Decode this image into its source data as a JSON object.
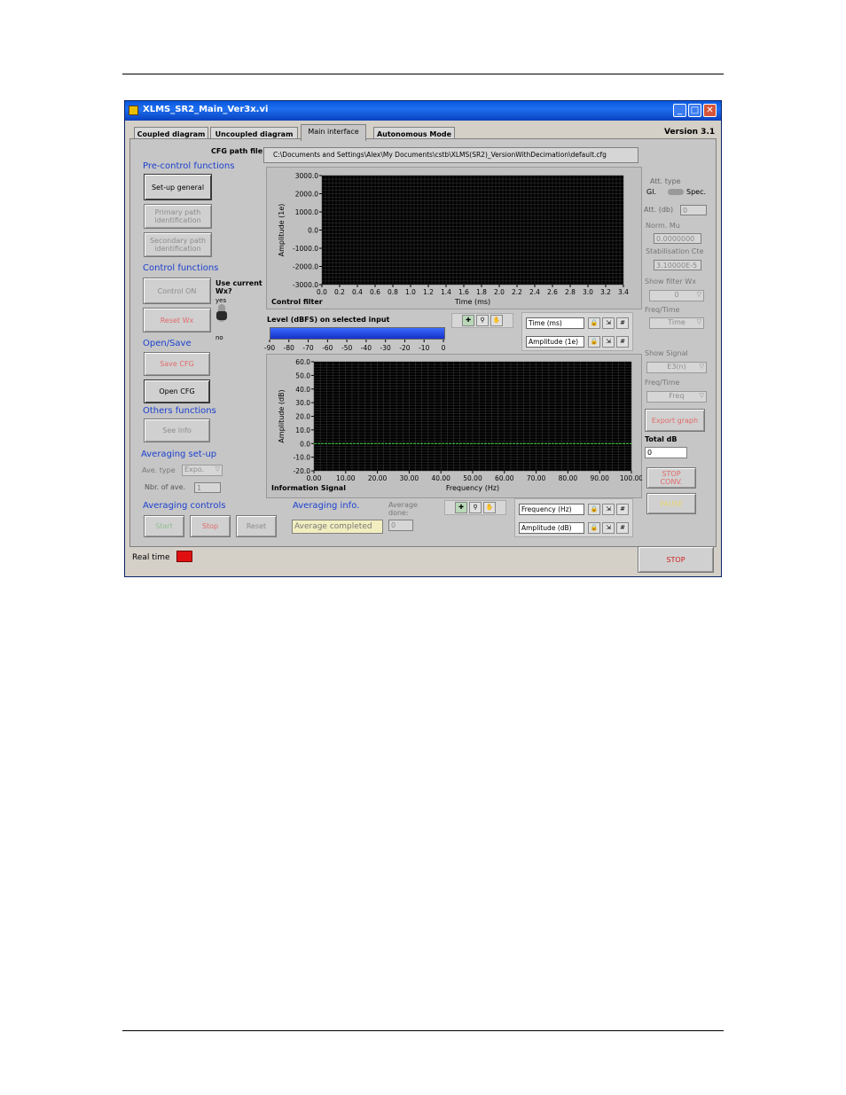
{
  "window": {
    "title": "XLMS_SR2_Main_Ver3x.vi",
    "controls": [
      "_",
      "□",
      "✕"
    ]
  },
  "tabs": [
    "Coupled diagram",
    "Uncoupled diagram",
    "Main interface",
    "Autonomous Mode"
  ],
  "version": "Version 3.1",
  "cfg": {
    "label": "CFG path file",
    "path": "C:\\Documents and Settings\\Alex\\My Documents\\cstb\\XLMS(SR2)_VersionWithDecimation\\default.cfg"
  },
  "sections": {
    "precontrol": "Pre-control functions",
    "control": "Control functions",
    "opensave": "Open/Save",
    "others": "Others functions",
    "averaging_setup": "Averaging set-up",
    "averaging_controls": "Averaging controls",
    "averaging_info": "Averaging info."
  },
  "buttons": {
    "setup_general": "Set-up general",
    "primary_path": [
      "Primary path",
      "identification"
    ],
    "secondary_path": [
      "Secondary path",
      "identification"
    ],
    "control_on": "Control ON",
    "reset_wx": "Reset Wx",
    "save_cfg": "Save CFG",
    "open_cfg": "Open CFG",
    "see_info": "See info",
    "start": "Start",
    "stop_avg": "Stop",
    "reset": "Reset",
    "export_graph": "Export graph",
    "stop_conv": [
      "STOP",
      "CONV."
    ],
    "pause": [
      "PAUSE"
    ],
    "stop": "STOP"
  },
  "use_wx": {
    "label": [
      "Use current",
      "Wx?"
    ],
    "yes": "yes",
    "no": "no"
  },
  "ave": {
    "type_label": "Ave. type",
    "type_value": "Expo.",
    "nbr_label": "Nbr. of ave.",
    "nbr_value": "1",
    "done_label": [
      "Average",
      "done:"
    ],
    "done_value": "0",
    "status": "Average completed"
  },
  "right": {
    "att_type": "Att. type",
    "gl": "Gl.",
    "spec": "Spec.",
    "att_db_label": "Att. (db)",
    "att_db_value": "0",
    "norm_mu_label": "Norm. Mu",
    "norm_mu_value": "0.0000000",
    "stab_label": "Stabilisation Cte",
    "stab_value": "3.10000E-5",
    "show_filter_label": "Show filter Wx",
    "show_filter_value": "0",
    "freqtime1_label": "Freq/Time",
    "freqtime1_value": "Time",
    "show_signal_label": "Show Signal",
    "show_signal_value": "E3(n)",
    "freqtime2_label": "Freq/Time",
    "freqtime2_value": "Freq",
    "total_db_label": "Total dB",
    "total_db_value": "0"
  },
  "level": {
    "label": "Level (dBFS) on selected input",
    "ticks": [
      "-90",
      "-80",
      "-70",
      "-60",
      "-50",
      "-40",
      "-30",
      "-20",
      "-10",
      "0"
    ],
    "fill": 1.0
  },
  "legend1": {
    "x": "Time (ms)",
    "y": "Amplitude (1e)"
  },
  "legend2": {
    "x": "Frequency (Hz)",
    "y": "Amplitude (dB)"
  },
  "realtime": "Real time",
  "chart_data": [
    {
      "type": "line",
      "title": "Control filter",
      "xlabel": "Time (ms)",
      "ylabel": "Amplitude (1e)",
      "xlim": [
        0,
        3.4
      ],
      "ylim": [
        -3000,
        3000
      ],
      "x_ticks": [
        "0.0",
        "0.2",
        "0.4",
        "0.6",
        "0.8",
        "1.0",
        "1.2",
        "1.4",
        "1.6",
        "1.8",
        "2.0",
        "2.2",
        "2.4",
        "2.6",
        "2.8",
        "3.0",
        "3.2",
        "3.4"
      ],
      "y_ticks": [
        "3000.0",
        "2000.0",
        "1000.0",
        "0.0",
        "-1000.0",
        "-2000.0",
        "-3000.0"
      ],
      "grid": true,
      "series": []
    },
    {
      "type": "line",
      "title": "Information Signal",
      "xlabel": "Frequency (Hz)",
      "ylabel": "Amplitude (dB)",
      "xlim": [
        0,
        100
      ],
      "ylim": [
        -20,
        60
      ],
      "x_ticks": [
        "0.00",
        "10.00",
        "20.00",
        "30.00",
        "40.00",
        "50.00",
        "60.00",
        "70.00",
        "80.00",
        "90.00",
        "100.00"
      ],
      "y_ticks": [
        "60.0",
        "50.0",
        "40.0",
        "30.0",
        "20.0",
        "10.0",
        "0.0",
        "-10.0",
        "-20.0"
      ],
      "grid": true,
      "series": [
        {
          "color": "#4ade4a",
          "x": [
            0,
            100
          ],
          "y": [
            0,
            0
          ]
        }
      ]
    }
  ]
}
